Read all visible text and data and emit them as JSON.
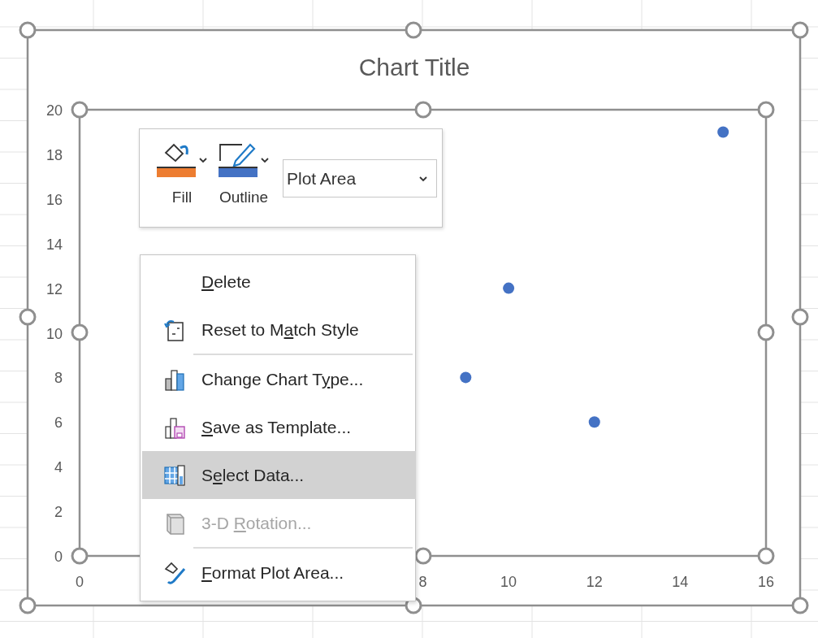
{
  "chart": {
    "chart_data": {
      "type": "scatter",
      "title": "Chart Title",
      "x": [
        9,
        10,
        12,
        15
      ],
      "series": [
        {
          "color": "#4472c4",
          "values": [
            8,
            12,
            6,
            19
          ]
        }
      ],
      "xlim": [
        0,
        16
      ],
      "ylim": [
        0,
        20
      ],
      "xticks": [
        0,
        8,
        10,
        12,
        14,
        16
      ],
      "yticks": [
        0,
        2,
        4,
        6,
        8,
        10,
        12,
        14,
        16,
        18,
        20
      ]
    }
  },
  "format_toolbar": {
    "buttons": [
      {
        "label": "Fill",
        "color": "#ed7d31"
      },
      {
        "label": "Outline",
        "color": "#4472c4"
      }
    ],
    "element_dropdown": {
      "value": "Plot Area"
    }
  },
  "menu": {
    "items": [
      {
        "kind": "item",
        "access_key": "D",
        "label_rest": "elete",
        "selected": false,
        "disabled": false
      },
      {
        "kind": "item",
        "label_start": "Reset to M",
        "access_key": "a",
        "label_rest": "tch Style",
        "selected": false,
        "disabled": false
      },
      {
        "kind": "separator"
      },
      {
        "kind": "item",
        "label_start": "Change Chart T",
        "access_key": "y",
        "label_rest": "pe...",
        "selected": false,
        "disabled": false
      },
      {
        "kind": "item",
        "access_key": "S",
        "label_rest": "ave as Template...",
        "selected": false,
        "disabled": false
      },
      {
        "kind": "item",
        "label_start": "S",
        "access_key": "e",
        "label_rest": "lect Data...",
        "selected": true,
        "disabled": false
      },
      {
        "kind": "item",
        "label_start": "3-D ",
        "access_key": "R",
        "label_rest": "otation...",
        "selected": false,
        "disabled": true
      },
      {
        "kind": "separator"
      },
      {
        "kind": "item",
        "access_key": "F",
        "label_rest": "ormat Plot Area...",
        "selected": false,
        "disabled": false
      }
    ]
  }
}
